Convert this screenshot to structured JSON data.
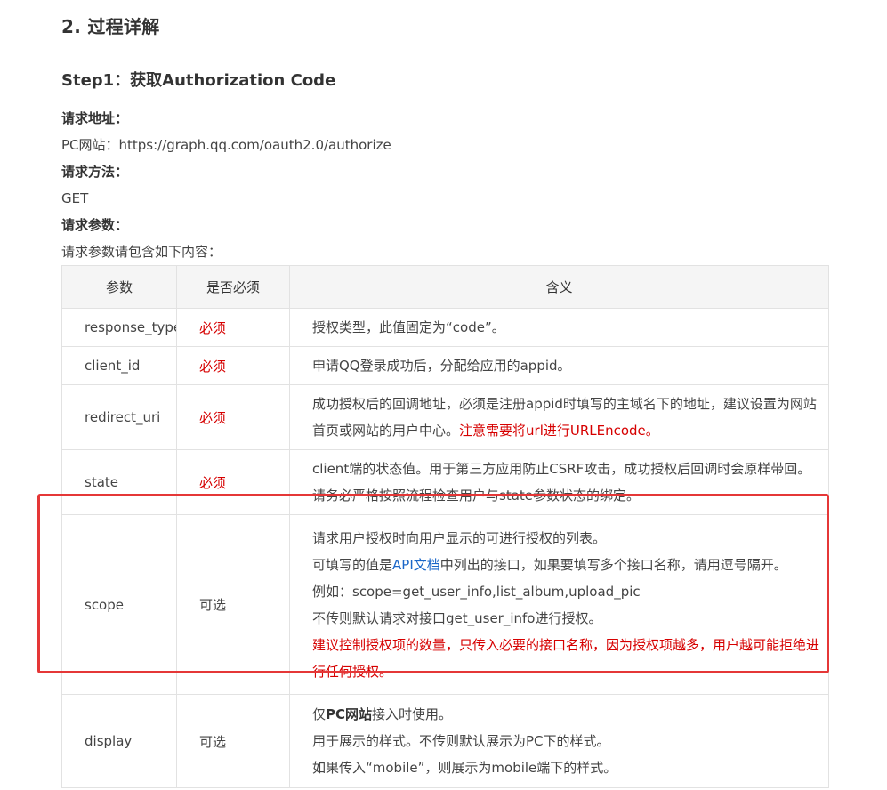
{
  "section_title": "2. 过程详解",
  "step_title": "Step1：获取Authorization Code",
  "request_url_label": "请求地址：",
  "request_url_value": "PC网站：https://graph.qq.com/oauth2.0/authorize",
  "request_method_label": "请求方法：",
  "request_method_value": "GET",
  "request_params_label": "请求参数：",
  "request_params_intro": "请求参数请包含如下内容：",
  "table": {
    "headers": [
      "参数",
      "是否必须",
      "含义"
    ],
    "rows": [
      {
        "name": "response_type",
        "required": "必须",
        "desc": "授权类型，此值固定为“code”。"
      },
      {
        "name": "client_id",
        "required": "必须",
        "desc": "申请QQ登录成功后，分配给应用的appid。"
      },
      {
        "name": "redirect_uri",
        "required": "必须",
        "desc_part1": "成功授权后的回调地址，必须是注册appid时填写的主域名下的地址，建议设置为网站首页或网站的用户中心。",
        "desc_part2": "注意需要将url进行URLEncode。"
      },
      {
        "name": "state",
        "required": "必须",
        "desc": "client端的状态值。用于第三方应用防止CSRF攻击，成功授权后回调时会原样带回。请务必严格按照流程检查用户与state参数状态的绑定。"
      },
      {
        "name": "scope",
        "required": "可选",
        "line1": "请求用户授权时向用户显示的可进行授权的列表。",
        "line2_pre": "可填写的值是",
        "line2_link": "API文档",
        "line2_post": "中列出的接口，如果要填写多个接口名称，请用逗号隔开。",
        "line3": "例如：scope=get_user_info,list_album,upload_pic",
        "line4": "不传则默认请求对接口get_user_info进行授权。",
        "line5": "建议控制授权项的数量，只传入必要的接口名称，因为授权项越多，用户越可能拒绝进行任何授权。"
      },
      {
        "name": "display",
        "required": "可选",
        "line1_pre": "仅",
        "line1_strong": "PC网站",
        "line1_post": "接入时使用。",
        "line2": "用于展示的样式。不传则默认展示为PC下的样式。",
        "line3": "如果传入“mobile”，则展示为mobile端下的样式。"
      }
    ]
  },
  "colors": {
    "required_text": "#d60000",
    "link": "#1a66c8",
    "highlight_border": "#e53737",
    "header_bg": "#f5f5f5"
  }
}
